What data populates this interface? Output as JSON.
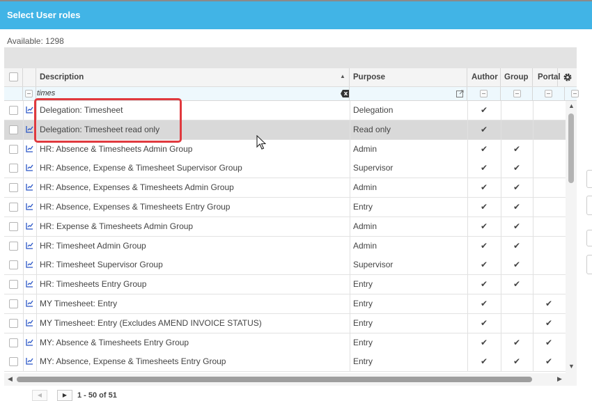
{
  "dialog": {
    "title": "Select User roles"
  },
  "available_label": "Available: 1298",
  "columns": {
    "description": "Description",
    "purpose": "Purpose",
    "author": "Author",
    "group": "Group",
    "portal": "Portal"
  },
  "filter": {
    "description_value": "times",
    "clear_icon": "clear-filter-icon"
  },
  "rows": [
    {
      "description": "Delegation: Timesheet",
      "purpose": "Delegation",
      "author": "✔",
      "group": "",
      "portal": ""
    },
    {
      "description": "Delegation: Timesheet read only",
      "purpose": "Read only",
      "author": "✔",
      "group": "",
      "portal": ""
    },
    {
      "description": "HR: Absence & Timesheets Admin Group",
      "purpose": "Admin",
      "author": "✔",
      "group": "✔",
      "portal": ""
    },
    {
      "description": "HR: Absence, Expense & Timesheet Supervisor Group",
      "purpose": "Supervisor",
      "author": "✔",
      "group": "✔",
      "portal": ""
    },
    {
      "description": "HR: Absence, Expenses & Timesheets Admin Group",
      "purpose": "Admin",
      "author": "✔",
      "group": "✔",
      "portal": ""
    },
    {
      "description": "HR: Absence, Expenses & Timesheets Entry Group",
      "purpose": "Entry",
      "author": "✔",
      "group": "✔",
      "portal": ""
    },
    {
      "description": "HR: Expense & Timesheets Admin Group",
      "purpose": "Admin",
      "author": "✔",
      "group": "✔",
      "portal": ""
    },
    {
      "description": "HR: Timesheet Admin Group",
      "purpose": "Admin",
      "author": "✔",
      "group": "✔",
      "portal": ""
    },
    {
      "description": "HR: Timesheet Supervisor Group",
      "purpose": "Supervisor",
      "author": "✔",
      "group": "✔",
      "portal": ""
    },
    {
      "description": "HR: Timesheets Entry Group",
      "purpose": "Entry",
      "author": "✔",
      "group": "✔",
      "portal": ""
    },
    {
      "description": "MY Timesheet: Entry",
      "purpose": "Entry",
      "author": "✔",
      "group": "",
      "portal": "✔"
    },
    {
      "description": "MY Timesheet: Entry (Excludes AMEND INVOICE STATUS)",
      "purpose": "Entry",
      "author": "✔",
      "group": "",
      "portal": "✔"
    },
    {
      "description": "MY: Absence & Timesheets Entry Group",
      "purpose": "Entry",
      "author": "✔",
      "group": "✔",
      "portal": "✔"
    },
    {
      "description": "MY: Absence, Expense & Timesheets Entry Group",
      "purpose": "Entry",
      "author": "✔",
      "group": "✔",
      "portal": "✔"
    }
  ],
  "pager": {
    "range": "1 - 50 of 51"
  },
  "colors": {
    "title_bar": "#41b4e6",
    "highlight": "#e0393e",
    "selected_row": "#d9d9d9"
  }
}
